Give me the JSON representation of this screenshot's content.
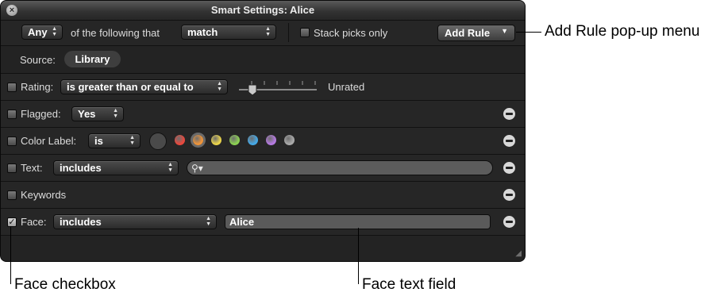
{
  "window": {
    "title": "Smart Settings: Alice",
    "close_glyph": "×"
  },
  "criteria": {
    "match_any": "Any",
    "following_text": "of the following that",
    "match_mode": "match",
    "stack_picks_label": "Stack picks only",
    "add_rule_label": "Add Rule"
  },
  "source": {
    "label": "Source:",
    "value": "Library"
  },
  "rules": {
    "rating": {
      "label": "Rating:",
      "operator": "is greater than or equal to",
      "value": "Unrated",
      "checked": false
    },
    "flagged": {
      "label": "Flagged:",
      "value": "Yes",
      "checked": false
    },
    "color_label": {
      "label": "Color Label:",
      "operator": "is",
      "checked": false,
      "colors": [
        "#555555",
        "#e8483d",
        "#f0953a",
        "#e9d34a",
        "#8bd052",
        "#45a8e6",
        "#b479e0",
        "#a9a9a9"
      ],
      "selected_index": 2
    },
    "text": {
      "label": "Text:",
      "operator": "includes",
      "search_value": "",
      "checked": false
    },
    "keywords": {
      "label": "Keywords",
      "checked": false
    },
    "face": {
      "label": "Face:",
      "operator": "includes",
      "value": "Alice",
      "checked": true,
      "check_glyph": "✓"
    }
  },
  "callouts": {
    "add_rule": "Add Rule pop-up menu",
    "face_checkbox": "Face checkbox",
    "face_text_field": "Face text field"
  }
}
